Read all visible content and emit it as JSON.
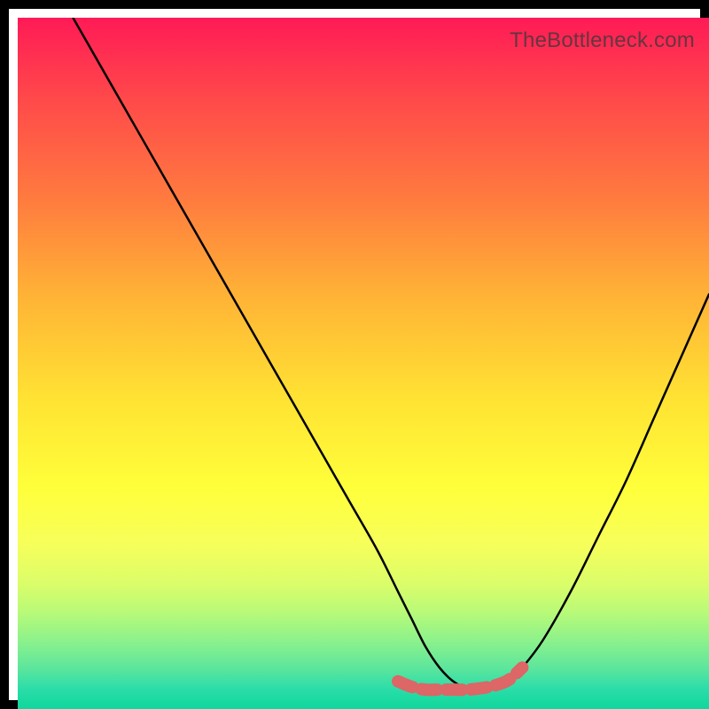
{
  "watermark": "TheBottleneck.com",
  "colors": {
    "frame": "#000000",
    "curve": "#000000",
    "marker": "#dd6666",
    "gradient_top": "#ff1a56",
    "gradient_bottom": "#11d79e"
  },
  "chart_data": {
    "type": "line",
    "title": "",
    "xlabel": "",
    "ylabel": "",
    "xlim": [
      0,
      100
    ],
    "ylim": [
      0,
      100
    ],
    "grid": false,
    "legend": false,
    "annotations": [
      "TheBottleneck.com"
    ],
    "series": [
      {
        "name": "bottleneck-curve",
        "x": [
          8,
          12,
          16,
          20,
          24,
          28,
          32,
          36,
          40,
          44,
          48,
          52,
          55,
          57,
          59,
          61,
          63,
          65,
          67,
          69,
          71,
          73,
          76,
          80,
          84,
          88,
          92,
          96,
          100
        ],
        "values": [
          100,
          93,
          86,
          79,
          72,
          65,
          58,
          51,
          44,
          37,
          30,
          23,
          17,
          13,
          9,
          6,
          4,
          3,
          3,
          3,
          4,
          6,
          10,
          17,
          25,
          33,
          42,
          51,
          60
        ]
      }
    ],
    "markers": [
      {
        "name": "highlight-segment",
        "color": "#dd6666",
        "x": [
          55,
          57,
          59,
          61,
          63,
          65,
          67,
          69,
          71,
          73
        ],
        "values": [
          4,
          3.2,
          2.8,
          2.8,
          2.8,
          2.8,
          3.0,
          3.4,
          4.2,
          6.0
        ]
      }
    ]
  }
}
